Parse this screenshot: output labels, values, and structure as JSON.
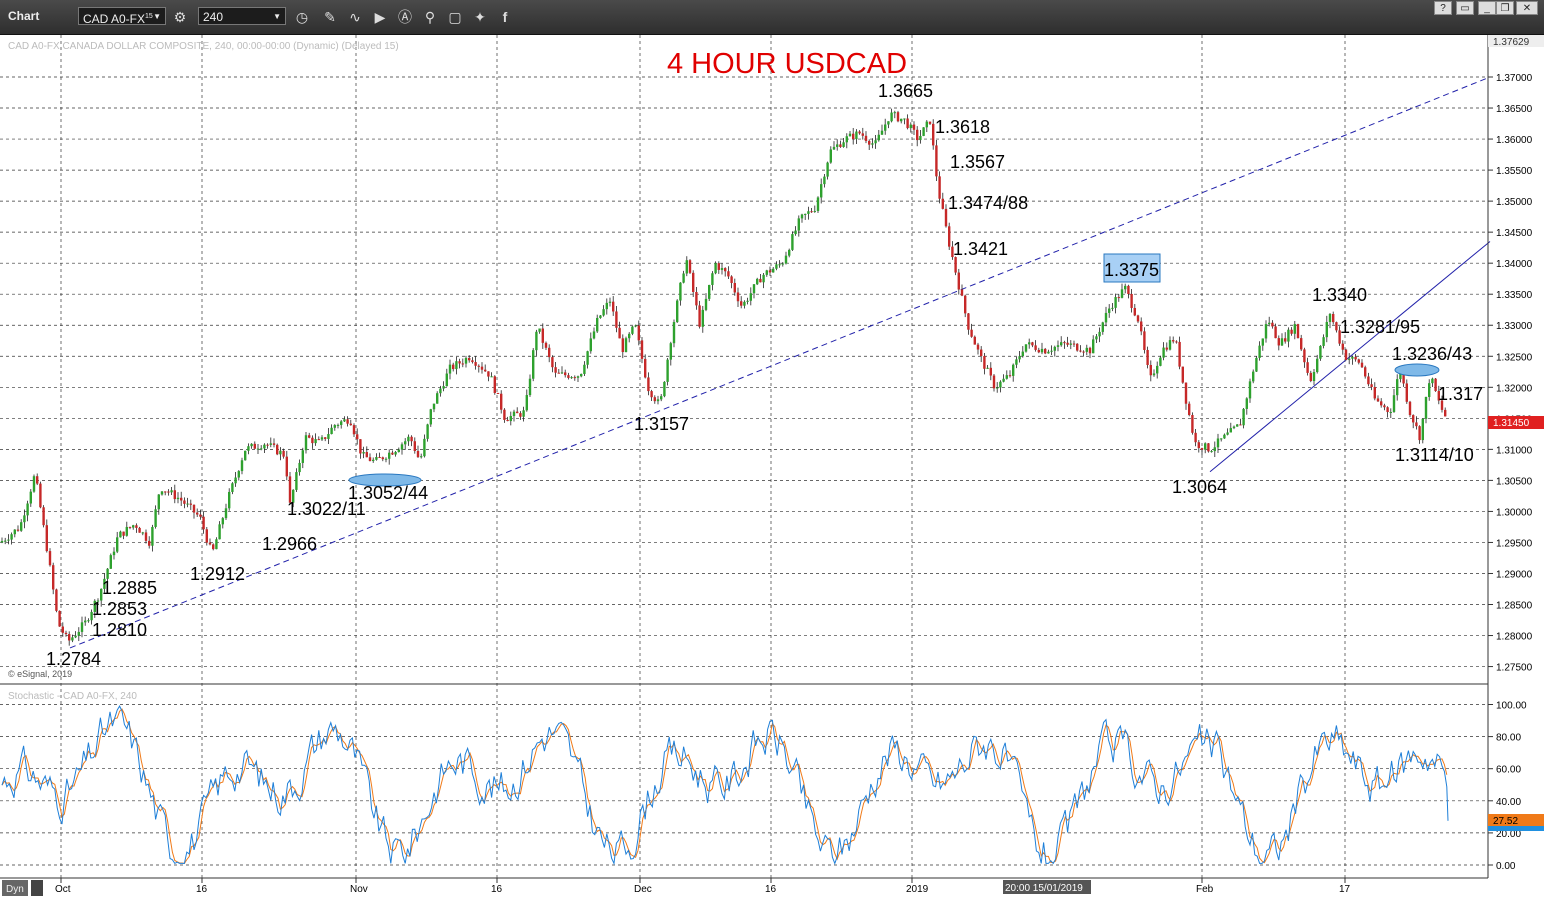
{
  "toolbar": {
    "title": "Chart",
    "symbol": "CAD A0-FX",
    "symbol_sup": "15",
    "interval": "240",
    "win_buttons": [
      "?",
      "",
      "",
      "",
      "✕"
    ]
  },
  "chart": {
    "title": "4 HOUR USDCAD",
    "header_info": "CAD A0-FX CANADA DOLLAR COMPOSITE, 240, 00:00-00:00 (Dynamic) (Delayed 15)",
    "watermark": "© eSignal, 2019",
    "current_price": "1.31450",
    "top_price": "1.37629",
    "price_ticks": [
      "1.37000",
      "1.36500",
      "1.36000",
      "1.35500",
      "1.35000",
      "1.34500",
      "1.34000",
      "1.33500",
      "1.33000",
      "1.32500",
      "1.32000",
      "1.31500",
      "1.31000",
      "1.30500",
      "1.30000",
      "1.29500",
      "1.29000",
      "1.28500",
      "1.28000",
      "1.27500"
    ],
    "annotations": [
      "1.3665",
      "1.3618",
      "1.3567",
      "1.3474/88",
      "1.3421",
      "1.3375",
      "1.3340",
      "1.3281/95",
      "1.3236/43",
      "1.317",
      "1.3114/10",
      "1.3064",
      "1.3157",
      "1.3052/44",
      "1.3022/11",
      "1.2966",
      "1.2912",
      "1.2885",
      "1.2853",
      "1.2810",
      "1.2784"
    ]
  },
  "stochastic": {
    "title": "Stochastic - CAD A0-FX, 240",
    "ticks": [
      "100.00",
      "80.00",
      "60.00",
      "40.00",
      "20.00",
      "0.00"
    ],
    "current_k": "27.52"
  },
  "x_axis": {
    "labels": [
      "Oct",
      "16",
      "Nov",
      "16",
      "Dec",
      "16",
      "2019",
      "20:00 15/01/2019",
      "Feb",
      "17"
    ],
    "footer_label": "Dyn"
  },
  "chart_data": {
    "type": "candlestick",
    "title": "4 HOUR USDCAD",
    "ylim": [
      1.27,
      1.3763
    ],
    "x_categories": [
      "Oct",
      "16",
      "Nov",
      "16",
      "Dec",
      "16",
      "2019",
      "Feb",
      "17"
    ],
    "key_levels": [
      {
        "label": "1.2784",
        "value": 1.2784
      },
      {
        "label": "1.2810",
        "value": 1.281
      },
      {
        "label": "1.2853",
        "value": 1.2853
      },
      {
        "label": "1.2885",
        "value": 1.2885
      },
      {
        "label": "1.2912",
        "value": 1.2912
      },
      {
        "label": "1.2966",
        "value": 1.2966
      },
      {
        "label": "1.3022/11",
        "value": 1.3022
      },
      {
        "label": "1.3052/44",
        "value": 1.3052
      },
      {
        "label": "1.3157",
        "value": 1.3157
      },
      {
        "label": "1.3665",
        "value": 1.3665
      },
      {
        "label": "1.3618",
        "value": 1.3618
      },
      {
        "label": "1.3567",
        "value": 1.3567
      },
      {
        "label": "1.3474/88",
        "value": 1.3474
      },
      {
        "label": "1.3421",
        "value": 1.3421
      },
      {
        "label": "1.3375",
        "value": 1.3375
      },
      {
        "label": "1.3064",
        "value": 1.3064
      },
      {
        "label": "1.3340",
        "value": 1.334
      },
      {
        "label": "1.3281/95",
        "value": 1.3281
      },
      {
        "label": "1.3236/43",
        "value": 1.3236
      },
      {
        "label": "1.317",
        "value": 1.317
      },
      {
        "label": "1.3114/10",
        "value": 1.3114
      }
    ],
    "price_path": [
      [
        0,
        1.295
      ],
      [
        20,
        1.2975
      ],
      [
        35,
        1.306
      ],
      [
        48,
        1.293
      ],
      [
        58,
        1.282
      ],
      [
        68,
        1.279
      ],
      [
        85,
        1.282
      ],
      [
        100,
        1.287
      ],
      [
        118,
        1.296
      ],
      [
        135,
        1.298
      ],
      [
        150,
        1.295
      ],
      [
        160,
        1.304
      ],
      [
        180,
        1.302
      ],
      [
        200,
        1.299
      ],
      [
        212,
        1.293
      ],
      [
        228,
        1.302
      ],
      [
        245,
        1.31
      ],
      [
        265,
        1.311
      ],
      [
        285,
        1.309
      ],
      [
        290,
        1.301
      ],
      [
        305,
        1.312
      ],
      [
        320,
        1.311
      ],
      [
        335,
        1.314
      ],
      [
        350,
        1.315
      ],
      [
        362,
        1.309
      ],
      [
        375,
        1.308
      ],
      [
        395,
        1.31
      ],
      [
        410,
        1.312
      ],
      [
        420,
        1.308
      ],
      [
        432,
        1.317
      ],
      [
        450,
        1.323
      ],
      [
        470,
        1.325
      ],
      [
        490,
        1.322
      ],
      [
        505,
        1.315
      ],
      [
        525,
        1.316
      ],
      [
        537,
        1.33
      ],
      [
        555,
        1.322
      ],
      [
        580,
        1.322
      ],
      [
        598,
        1.331
      ],
      [
        610,
        1.334
      ],
      [
        622,
        1.326
      ],
      [
        635,
        1.33
      ],
      [
        648,
        1.32
      ],
      [
        660,
        1.317
      ],
      [
        672,
        1.329
      ],
      [
        686,
        1.341
      ],
      [
        700,
        1.33
      ],
      [
        715,
        1.34
      ],
      [
        728,
        1.338
      ],
      [
        742,
        1.333
      ],
      [
        762,
        1.338
      ],
      [
        782,
        1.34
      ],
      [
        800,
        1.347
      ],
      [
        815,
        1.349
      ],
      [
        830,
        1.358
      ],
      [
        845,
        1.36
      ],
      [
        860,
        1.361
      ],
      [
        875,
        1.359
      ],
      [
        890,
        1.364
      ],
      [
        905,
        1.363
      ],
      [
        918,
        1.36
      ],
      [
        930,
        1.363
      ],
      [
        938,
        1.352
      ],
      [
        948,
        1.344
      ],
      [
        958,
        1.337
      ],
      [
        968,
        1.33
      ],
      [
        980,
        1.325
      ],
      [
        995,
        1.32
      ],
      [
        1010,
        1.322
      ],
      [
        1025,
        1.327
      ],
      [
        1045,
        1.326
      ],
      [
        1065,
        1.327
      ],
      [
        1090,
        1.326
      ],
      [
        1110,
        1.333
      ],
      [
        1125,
        1.336
      ],
      [
        1138,
        1.331
      ],
      [
        1150,
        1.321
      ],
      [
        1162,
        1.326
      ],
      [
        1175,
        1.328
      ],
      [
        1186,
        1.318
      ],
      [
        1195,
        1.311
      ],
      [
        1210,
        1.31
      ],
      [
        1225,
        1.312
      ],
      [
        1240,
        1.314
      ],
      [
        1255,
        1.324
      ],
      [
        1268,
        1.331
      ],
      [
        1280,
        1.327
      ],
      [
        1295,
        1.33
      ],
      [
        1310,
        1.321
      ],
      [
        1320,
        1.326
      ],
      [
        1330,
        1.332
      ],
      [
        1345,
        1.325
      ],
      [
        1360,
        1.324
      ],
      [
        1375,
        1.318
      ],
      [
        1390,
        1.316
      ],
      [
        1400,
        1.323
      ],
      [
        1410,
        1.316
      ],
      [
        1420,
        1.312
      ],
      [
        1430,
        1.322
      ],
      [
        1440,
        1.317
      ],
      [
        1448,
        1.3145
      ]
    ],
    "trendlines": [
      {
        "style": "dashed",
        "from": [
          70,
          1.278
        ],
        "to": [
          1490,
          1.37
        ]
      },
      {
        "style": "solid",
        "from": [
          1210,
          1.3064
        ],
        "to": [
          1490,
          1.3435
        ]
      }
    ],
    "stochastic_range": [
      0,
      100
    ],
    "stochastic_levels": [
      20,
      80
    ],
    "stochastic_last": 27.52
  }
}
